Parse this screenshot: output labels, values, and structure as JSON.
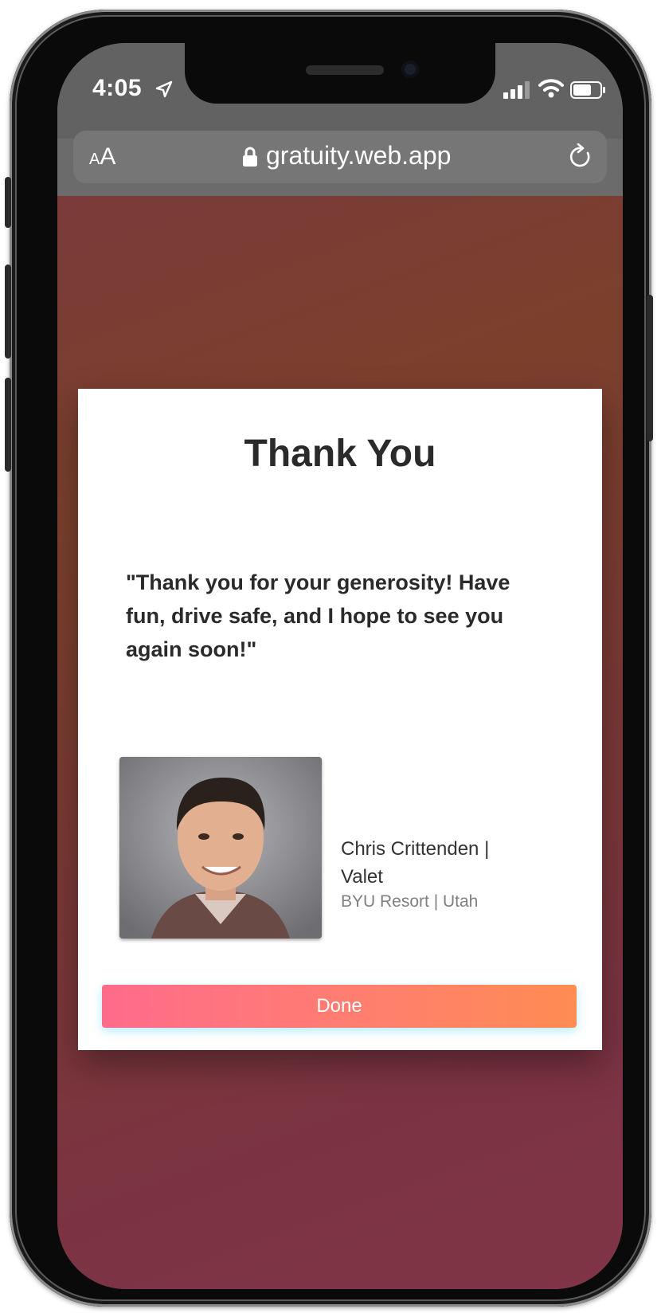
{
  "status_bar": {
    "time": "4:05",
    "icons": [
      "location-arrow-icon",
      "cellular-signal-icon",
      "wifi-icon",
      "battery-icon"
    ]
  },
  "browser": {
    "text_size_button": {
      "small": "A",
      "large": "A"
    },
    "url": "gratuity.web.app",
    "icons": [
      "lock-icon",
      "reload-icon"
    ]
  },
  "card": {
    "title": "Thank You",
    "message": "\"Thank you for your generosity! Have fun, drive safe, and I hope to see you again soon!\"",
    "employee": {
      "name_role": "Chris Crittenden | Valet",
      "location": "BYU Resort | Utah"
    },
    "done_label": "Done"
  },
  "colors": {
    "background_top": "#7b402c",
    "background_bottom": "#803446",
    "button_start": "#ff6b8b",
    "button_end": "#ff8c52"
  }
}
